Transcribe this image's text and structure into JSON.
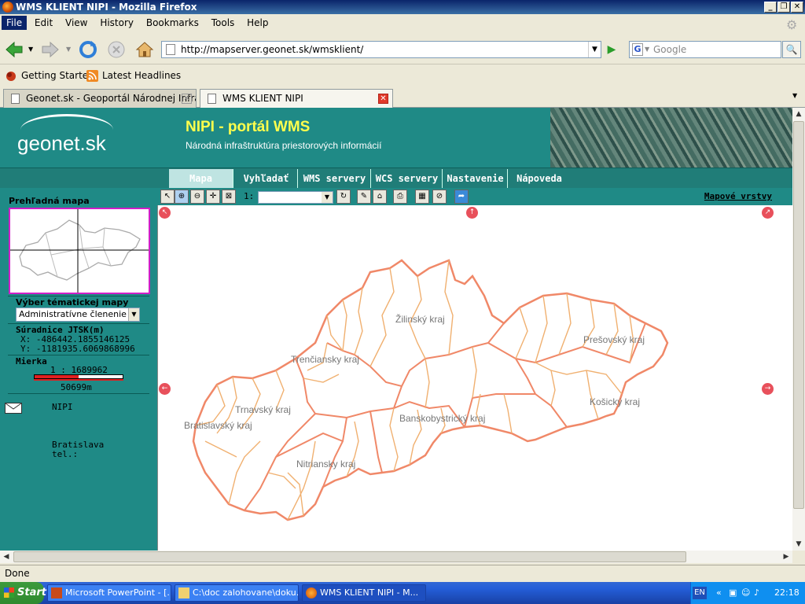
{
  "window": {
    "title": "WMS KLIENT NIPI - Mozilla Firefox"
  },
  "menu": [
    "File",
    "Edit",
    "View",
    "History",
    "Bookmarks",
    "Tools",
    "Help"
  ],
  "address": {
    "url": "http://mapserver.geonet.sk/wmsklient/"
  },
  "search": {
    "placeholder": "Google",
    "engine_letter": "G"
  },
  "bookmarks": [
    "Getting Started",
    "Latest Headlines"
  ],
  "tabs": [
    {
      "label": "Geonet.sk - Geoportál Národnej Infra..."
    },
    {
      "label": "WMS KLIENT NIPI"
    }
  ],
  "page": {
    "logo": "geonet.sk",
    "title": "NIPI - portál WMS",
    "subtitle": "Národná infraštruktúra priestorových informácií",
    "nav": [
      "Mapa",
      "Vyhľadať",
      "WMS servery",
      "WCS servery",
      "Nastavenie",
      "Nápoveda"
    ],
    "sidebar": {
      "overview_label": "Prehľadná mapa",
      "theme_label": "Výber tématickej mapy",
      "theme_value": "Administratívne členenie",
      "coords_label": "Súradnice JTSK(m)",
      "x": "X: -486442.1855146125",
      "y": "Y: -1181935.6069868996",
      "scale_label": "Mierka",
      "scale_ratio": "1 : 1689962",
      "scale_bar": "50699m",
      "contact_name": "NIPI",
      "contact_city": "Bratislava",
      "contact_tel": "tel.:"
    },
    "map_toolbar": {
      "scale_prefix": "1:",
      "layers_link": "Mapové vrstvy"
    },
    "regions": [
      "Žilinský kraj",
      "Prešovský kraj",
      "Trenčiansky kraj",
      "Trnavský kraj",
      "Bratislavský kraj",
      "Banskobystrický kraj",
      "Košický kraj",
      "Nitriansky kraj"
    ]
  },
  "status": "Done",
  "taskbar": {
    "start": "Start",
    "tasks": [
      "Microsoft PowerPoint - [...",
      "C:\\doc zalohovane\\doku...",
      "WMS KLIENT NIPI - M..."
    ],
    "lang": "EN",
    "clock": "22:18"
  },
  "colors": {
    "teal": "#1f8a86",
    "title_yellow": "#ffff4c",
    "region_outline": "#f08868",
    "district_outline": "#f0b070"
  }
}
